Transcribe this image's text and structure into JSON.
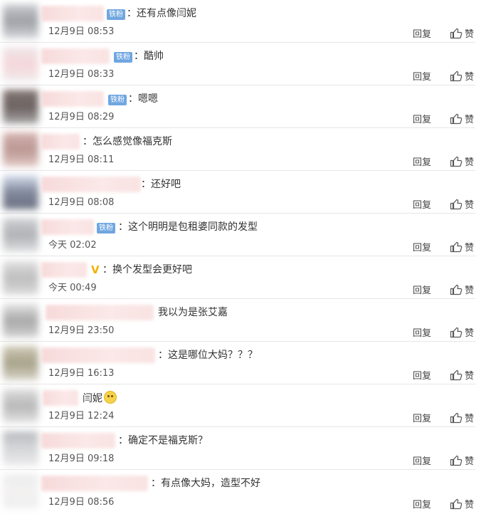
{
  "actions": {
    "reply_label": "回复",
    "like_label": "赞",
    "like_icon": "thumbs-up-icon"
  },
  "badge_label": "铁粉",
  "comments": [
    {
      "text": "：还有点像闫妮",
      "time": "12月9日 08:53",
      "badge": true,
      "vip": false
    },
    {
      "text": "：酷帅",
      "time": "12月9日 08:33",
      "badge": true,
      "vip": false
    },
    {
      "text": "：嗯嗯",
      "time": "12月9日 08:29",
      "badge": true,
      "vip": false
    },
    {
      "text": "：怎么感觉像福克斯",
      "time": "12月9日 08:11",
      "badge": false,
      "vip": false
    },
    {
      "text": "：还好吧",
      "time": "12月9日 08:08",
      "badge": false,
      "vip": false
    },
    {
      "text": "：这个明明是包租婆同款的发型",
      "time": "今天 02:02",
      "badge": true,
      "vip": false
    },
    {
      "text": "：换个发型会更好吧",
      "time": "今天 00:49",
      "badge": false,
      "vip": true
    },
    {
      "text": "我以为是张艾嘉",
      "time": "12月9日 23:50",
      "badge": false,
      "vip": false
    },
    {
      "text": "：这是哪位大妈？？？",
      "time": "12月9日 16:13",
      "badge": false,
      "vip": false
    },
    {
      "text": "闫妮",
      "time": "12月9日 12:24",
      "badge": false,
      "vip": false,
      "emoji": "smile-emoji"
    },
    {
      "text": "：确定不是福克斯？",
      "time": "12月9日 09:18",
      "badge": false,
      "vip": false
    },
    {
      "text": "：有点像大妈，造型不好",
      "time": "12月9日 08:56",
      "badge": false,
      "vip": false
    }
  ],
  "vip_mark": "V"
}
